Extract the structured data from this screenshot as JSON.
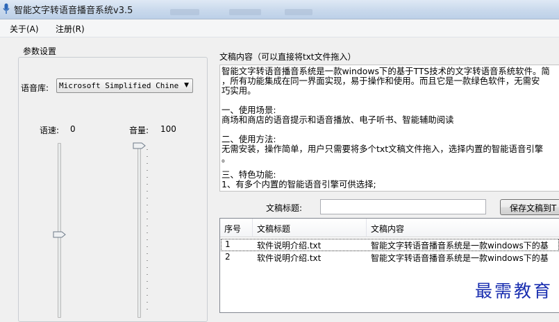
{
  "window": {
    "title": "智能文字转语音播音系统v3.5"
  },
  "menu": {
    "about": "关于(A)",
    "register": "注册(R)"
  },
  "params": {
    "group_title": "参数设置",
    "voice_label": "语音库:",
    "voice_value": "Microsoft Simplified Chine",
    "speed_label": "语速:",
    "speed_value": "0",
    "volume_label": "音量:",
    "volume_value": "100"
  },
  "content": {
    "label": "文稿内容（可以直接将txt文件拖入）",
    "lines": [
      "智能文字转语音播音系统是一款windows下的基于TTS技术的文字转语音系统软件。简",
      "，所有功能集成在同一界面实现，易于操作和使用。而且它是一款绿色软件，无需安",
      "巧实用。",
      "",
      "一、使用场景:",
      "商场和商店的语音提示和语音播放、电子听书、智能辅助阅读",
      "",
      "二、使用方法:",
      "无需安装，操作简单，用户只需要将多个txt文稿文件拖入，选择内置的智能语音引擎",
      "。",
      "",
      "三、特色功能:",
      "1、有多个内置的智能语音引擎可供选择;"
    ]
  },
  "doc_title": {
    "label": "文稿标题:",
    "value": "",
    "save_button": "保存文稿到T"
  },
  "table": {
    "columns": [
      "序号",
      "文稿标题",
      "文稿内容"
    ],
    "rows": [
      [
        "1",
        "软件说明介绍.txt",
        "智能文字转语音播音系统是一款windows下的基"
      ],
      [
        "2",
        "软件说明介绍.txt",
        "智能文字转语音播音系统是一款windows下的基"
      ]
    ]
  },
  "watermark": "最需教育"
}
